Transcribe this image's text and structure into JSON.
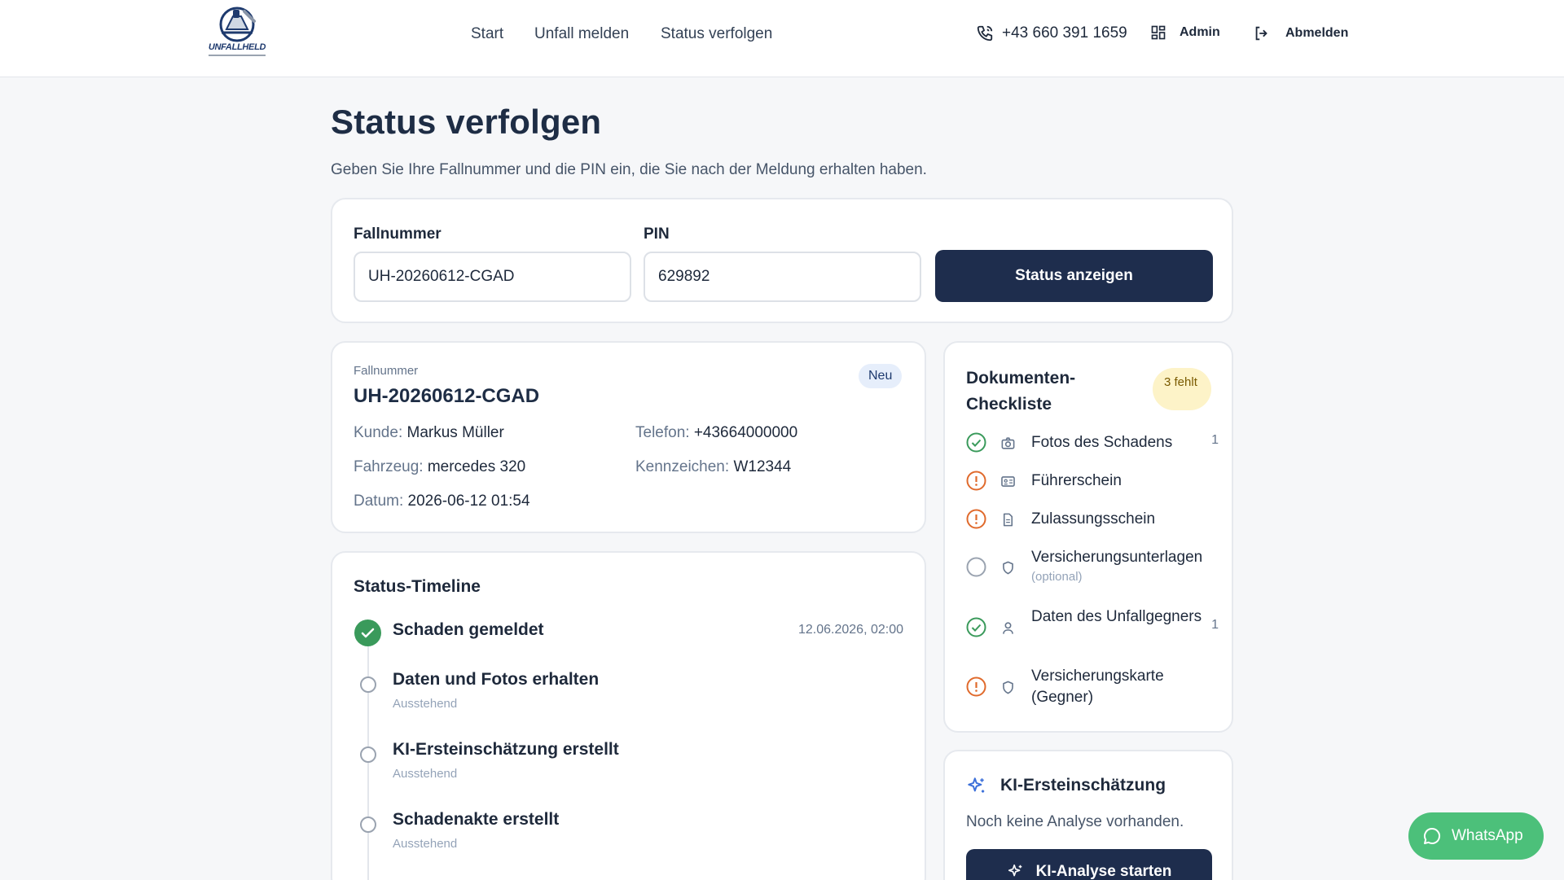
{
  "header": {
    "logo_text": "UNFALLHELD",
    "nav": [
      "Start",
      "Unfall melden",
      "Status verfolgen"
    ],
    "phone": "+43 660 391 1659",
    "admin_label": "Admin",
    "logout_label": "Abmelden"
  },
  "page": {
    "title": "Status verfolgen",
    "description": "Geben Sie Ihre Fallnummer und die PIN ein, die Sie nach der Meldung erhalten haben."
  },
  "form": {
    "case_label": "Fallnummer",
    "case_value": "UH-20260612-CGAD",
    "pin_label": "PIN",
    "pin_value": "629892",
    "submit_label": "Status anzeigen"
  },
  "case": {
    "number_label": "Fallnummer",
    "number": "UH-20260612-CGAD",
    "status_badge": "Neu",
    "customer_label": "Kunde:",
    "customer": "Markus Müller",
    "phone_label": "Telefon:",
    "phone": "+43664000000",
    "vehicle_label": "Fahrzeug:",
    "vehicle": "mercedes 320",
    "plate_label": "Kennzeichen:",
    "plate": "W12344",
    "date_label": "Datum:",
    "date": "2026-06-12 01:54"
  },
  "timeline": {
    "title": "Status-Timeline",
    "steps": [
      {
        "name": "Schaden gemeldet",
        "sub": "",
        "date": "12.06.2026, 02:00",
        "state": "done"
      },
      {
        "name": "Daten und Fotos erhalten",
        "sub": "Ausstehend",
        "date": "",
        "state": "pending"
      },
      {
        "name": "KI-Ersteinschätzung erstellt",
        "sub": "Ausstehend",
        "date": "",
        "state": "pending"
      },
      {
        "name": "Schadenakte erstellt",
        "sub": "Ausstehend",
        "date": "",
        "state": "pending"
      }
    ]
  },
  "checklist": {
    "title": "Dokumenten-Checkliste",
    "badge": "3 fehlt",
    "items": [
      {
        "label": "Fotos des Schadens",
        "note": "",
        "count": "1",
        "state": "ok",
        "icon": "camera-icon"
      },
      {
        "label": "Führerschein",
        "note": "",
        "count": "",
        "state": "missing",
        "icon": "id-card-icon"
      },
      {
        "label": "Zulassungsschein",
        "note": "",
        "count": "",
        "state": "missing",
        "icon": "document-icon"
      },
      {
        "label": "Versicherungsunterlagen",
        "note": "(optional)",
        "count": "",
        "state": "optional",
        "icon": "shield-icon"
      },
      {
        "label": "Daten des Unfallgegners",
        "note": "",
        "count": "1",
        "state": "ok",
        "icon": "user-icon"
      },
      {
        "label": "Versicherungskarte (Gegner)",
        "note": "",
        "count": "",
        "state": "missing",
        "icon": "shield-icon"
      }
    ]
  },
  "ki": {
    "title": "KI-Ersteinschätzung",
    "description": "Noch keine Analyse vorhanden.",
    "button_label": "KI-Analyse starten"
  },
  "whatsapp": {
    "label": "WhatsApp"
  },
  "colors": {
    "primary": "#1e2d4d",
    "success": "#3a9a5b",
    "warning": "#e06a2c",
    "whatsapp": "#4cc07a"
  }
}
